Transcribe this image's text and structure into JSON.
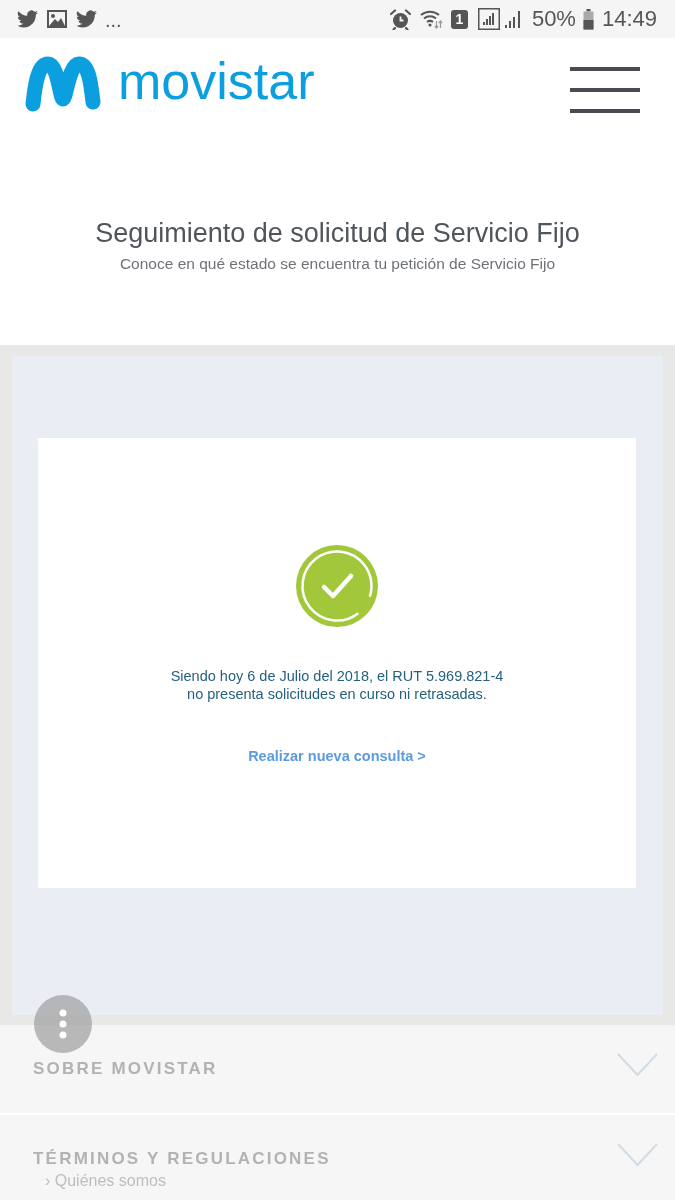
{
  "status_bar": {
    "overflow": "...",
    "sim_slot": "1",
    "battery": "50%",
    "time": "14:49"
  },
  "header": {
    "logo_text": "movistar"
  },
  "intro": {
    "title": "Seguimiento de solicitud de Servicio Fijo",
    "subtitle": "Conoce en qué estado se encuentra tu petición de Servicio Fijo"
  },
  "result_card": {
    "message_lines": [
      "Siendo hoy 6 de Julio del 2018, el RUT 5.969.821-4",
      "no presenta solicitudes en curso ni retrasadas."
    ],
    "link": "Realizar nueva consulta >"
  },
  "footer": {
    "sections": [
      {
        "title": "SOBRE MOVISTAR",
        "expanded": false
      },
      {
        "title": "TÉRMINOS Y REGULACIONES",
        "expanded": false
      }
    ],
    "link": "› Quiénes somos"
  }
}
